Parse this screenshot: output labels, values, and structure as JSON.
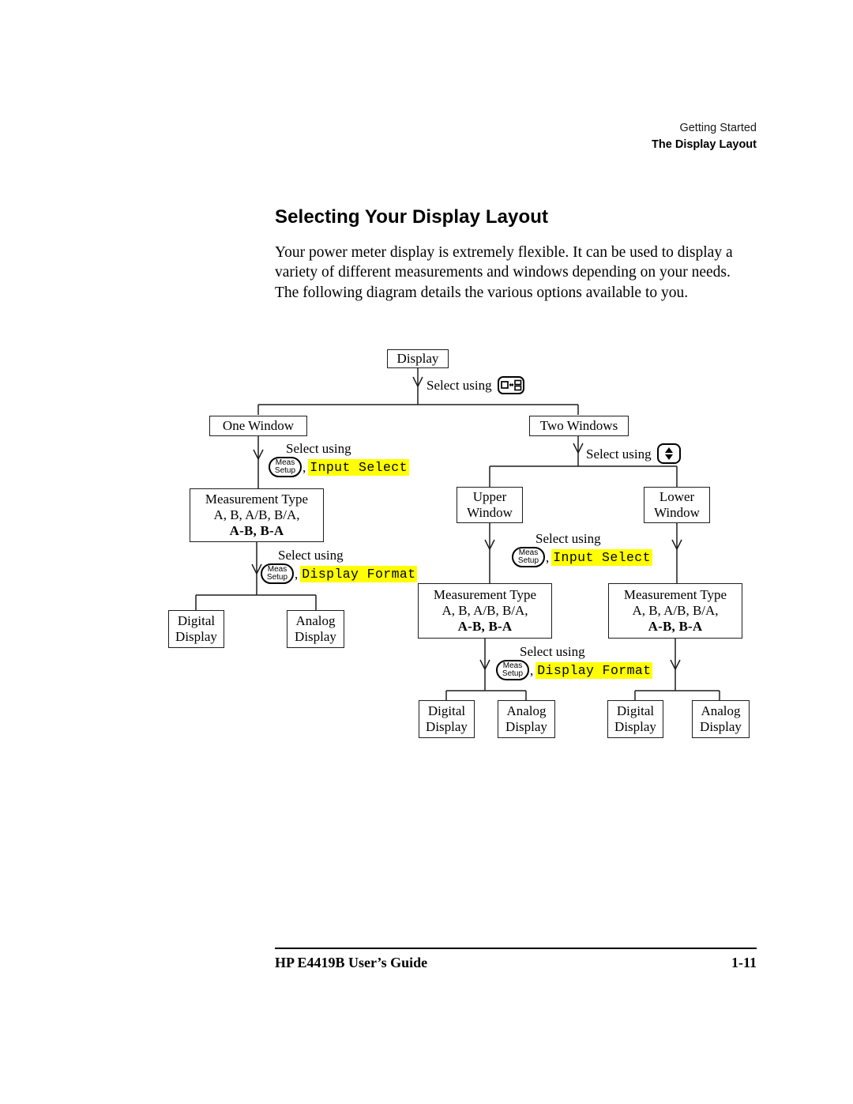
{
  "header": {
    "chapter": "Getting Started",
    "section": "The Display Layout"
  },
  "title": "Selecting Your Display Layout",
  "intro": "Your power meter display is extremely flexible. It can be used to display a variety of different measurements and windows depending on your needs. The following diagram details the various options available to you.",
  "labels": {
    "select_using": "Select using",
    "comma": ",",
    "meas_setup_line1": "Meas",
    "meas_setup_line2": "Setup",
    "input_select": "Input Select",
    "display_format": "Display Format"
  },
  "icons": {
    "window_split": "window-split-key-icon",
    "up_down": "up-down-arrow-key-icon"
  },
  "diagram": {
    "root": "Display",
    "one_window": "One Window",
    "two_windows": "Two Windows",
    "upper_window_l1": "Upper",
    "upper_window_l2": "Window",
    "lower_window_l1": "Lower",
    "lower_window_l2": "Window",
    "meas_type_l1": "Measurement Type",
    "meas_type_l2": "A, B, A/B, B/A,",
    "meas_type_l3": "A-B, B-A",
    "digital_l1": "Digital",
    "digital_l2": "Display",
    "analog_l1": "Analog",
    "analog_l2": "Display"
  },
  "footer": {
    "left": "HP E4419B User’s Guide",
    "right": "1-11"
  },
  "colors": {
    "highlight": "#FFFF00",
    "line": "#1d1d1d",
    "text": "#000000"
  }
}
